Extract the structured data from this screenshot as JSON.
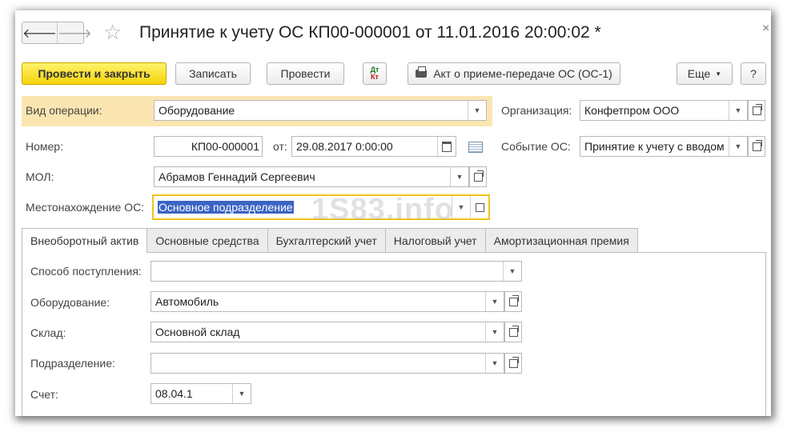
{
  "title": "Принятие к учету ОС КП00-000001 от 11.01.2016 20:00:02 *",
  "toolbar": {
    "post_close": "Провести и закрыть",
    "save": "Записать",
    "post": "Провести",
    "dt": "Дт",
    "kt": "Кт",
    "act": "Акт о приеме-передаче ОС (ОС-1)",
    "more": "Еще",
    "help": "?"
  },
  "header": {
    "operation_label": "Вид операции:",
    "operation_value": "Оборудование",
    "org_label": "Организация:",
    "org_value": "Конфетпром ООО",
    "number_label": "Номер:",
    "number_value": "КП00-000001",
    "from_label": "от:",
    "date_value": "29.08.2017  0:00:00",
    "event_label": "Событие ОС:",
    "event_value": "Принятие к учету с вводом",
    "mol_label": "МОЛ:",
    "mol_value": "Абрамов Геннадий Сергеевич",
    "location_label": "Местонахождение ОС:",
    "location_value": "Основное подразделение"
  },
  "watermark": "1S83.info",
  "tabs": [
    {
      "label": "Внеоборотный актив"
    },
    {
      "label": "Основные средства"
    },
    {
      "label": "Бухгалтерский учет"
    },
    {
      "label": "Налоговый учет"
    },
    {
      "label": "Амортизационная премия"
    }
  ],
  "form": {
    "receipt_label": "Способ поступления:",
    "receipt_value": "",
    "equipment_label": "Оборудование:",
    "equipment_value": "Автомобиль",
    "warehouse_label": "Склад:",
    "warehouse_value": "Основной склад",
    "division_label": "Подразделение:",
    "division_value": "",
    "account_label": "Счет:",
    "account_value": "08.04.1"
  }
}
